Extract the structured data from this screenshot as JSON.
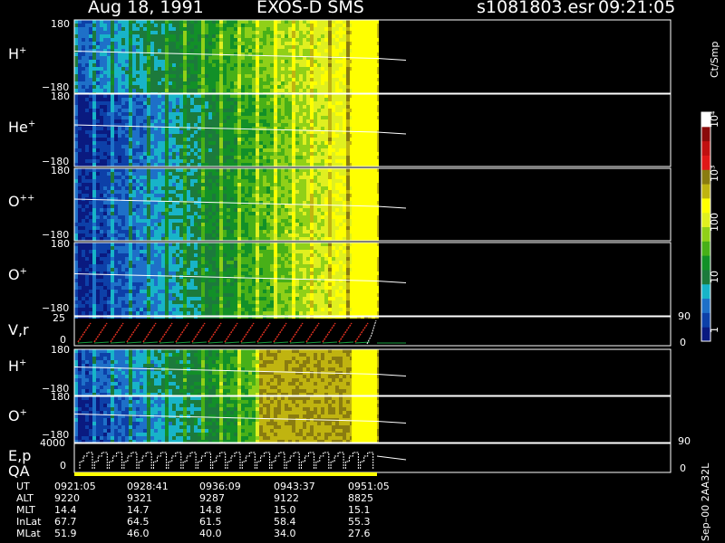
{
  "header": {
    "date": "Aug 18, 1991",
    "instrument": "EXOS-D SMS",
    "file": "s1081803.esr",
    "time": "09:21:05"
  },
  "colors": {
    "scale": [
      "#0a1a80",
      "#0d40a8",
      "#1e70c8",
      "#18b4c8",
      "#1c7a3c",
      "#129028",
      "#48b018",
      "#90d018",
      "#e0f020",
      "#ffff00",
      "#c0b410",
      "#8a7c10",
      "#e01818",
      "#c01010",
      "#8a0a0a",
      "#ffffff"
    ]
  },
  "colorbar": {
    "unit_label": "Ct/Smp",
    "tick_labels": [
      "10⁴",
      "10³",
      "100",
      "10",
      "1"
    ]
  },
  "panels": [
    {
      "id": "h-plus",
      "label": "H",
      "sup": "+",
      "ymax": "180",
      "ymin": "−180"
    },
    {
      "id": "he-plus",
      "label": "He",
      "sup": "+",
      "ymax": "180",
      "ymin": "−180"
    },
    {
      "id": "o-plus-plus",
      "label": "O",
      "sup": "++",
      "ymax": "180",
      "ymin": "−180"
    },
    {
      "id": "o-plus",
      "label": "O",
      "sup": "+",
      "ymax": "180",
      "ymin": "−180"
    },
    {
      "id": "h-plus-2",
      "label": "H",
      "sup": "+",
      "ymax": "180",
      "ymin": "−180"
    },
    {
      "id": "o-plus-2",
      "label": "O",
      "sup": "+",
      "ymax": "180",
      "ymin": "−180"
    }
  ],
  "vr_panel": {
    "label": "V,r",
    "ymax": "25",
    "ymin": "0",
    "right_top": "90",
    "right_bottom": "0"
  },
  "ep_panel": {
    "label1": "E,p",
    "label2": "QA",
    "ymax": "4000",
    "ymin": "0",
    "right_top": "90",
    "right_bottom": "0"
  },
  "ephemeris": {
    "rows": [
      {
        "label": "UT",
        "values": [
          "0921:05",
          "0928:41",
          "0936:09",
          "0943:37",
          "0951:05"
        ]
      },
      {
        "label": "ALT",
        "values": [
          "9220",
          "9321",
          "9287",
          "9122",
          "8825"
        ]
      },
      {
        "label": "MLT",
        "values": [
          "14.4",
          "14.7",
          "14.8",
          "15.0",
          "15.1"
        ]
      },
      {
        "label": "InLat",
        "values": [
          "67.7",
          "64.5",
          "61.5",
          "58.4",
          "55.3"
        ]
      },
      {
        "label": "MLat",
        "values": [
          "51.9",
          "46.0",
          "40.0",
          "34.0",
          "27.6"
        ]
      }
    ]
  },
  "footer_note": "Sep–00 2AA32L",
  "chart_data": {
    "type": "heatmap",
    "x_ticks_ut": [
      "0921:05",
      "0928:41",
      "0936:09",
      "0943:37",
      "0951:05"
    ],
    "series": [
      {
        "name": "H+",
        "ylim": [
          -180,
          180
        ]
      },
      {
        "name": "He+",
        "ylim": [
          -180,
          180
        ]
      },
      {
        "name": "O++",
        "ylim": [
          -180,
          180
        ]
      },
      {
        "name": "O+",
        "ylim": [
          -180,
          180
        ]
      },
      {
        "name": "V,r",
        "ylim": [
          0,
          25
        ]
      },
      {
        "name": "H+",
        "ylim": [
          -180,
          180
        ]
      },
      {
        "name": "O+",
        "ylim": [
          -180,
          180
        ]
      },
      {
        "name": "E,p",
        "ylim": [
          0,
          4000
        ]
      }
    ],
    "colorbar": {
      "label": "Ct/Smp",
      "scale": "log",
      "range": [
        1,
        10000
      ]
    }
  }
}
